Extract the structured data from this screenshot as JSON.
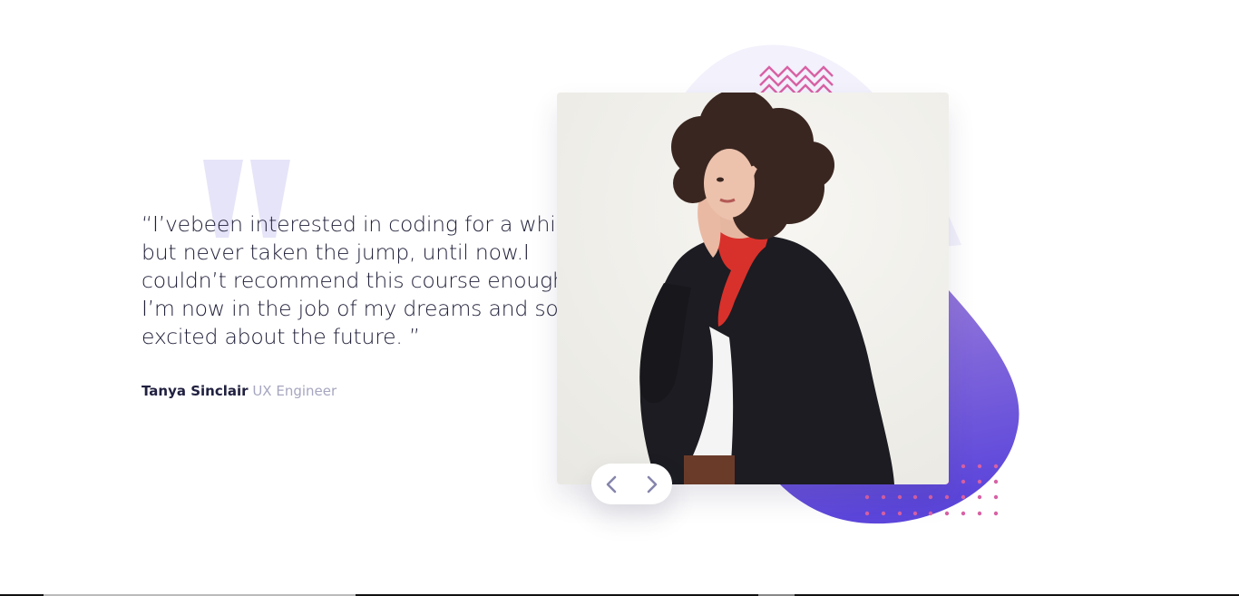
{
  "quote": {
    "text": "“I’vebeen interested in coding for a while but never taken the jump, until now.I couldn’t recommend this course enough. I’m now in the job of my dreams and so excited about the future. ”"
  },
  "author": {
    "name": "Tanya Sinclair",
    "role": "UX Engineer"
  },
  "navigation": {
    "prev_icon": "chevron-left-icon",
    "next_icon": "chevron-right-icon"
  },
  "colors": {
    "text_dark": "#1e1e38",
    "text_muted": "#a6a6c0",
    "blob_purple": "#6b50db",
    "blob_light": "#f2f1fc",
    "accent_pink": "#d861a4",
    "quote_mark": "#e6e4f8"
  }
}
